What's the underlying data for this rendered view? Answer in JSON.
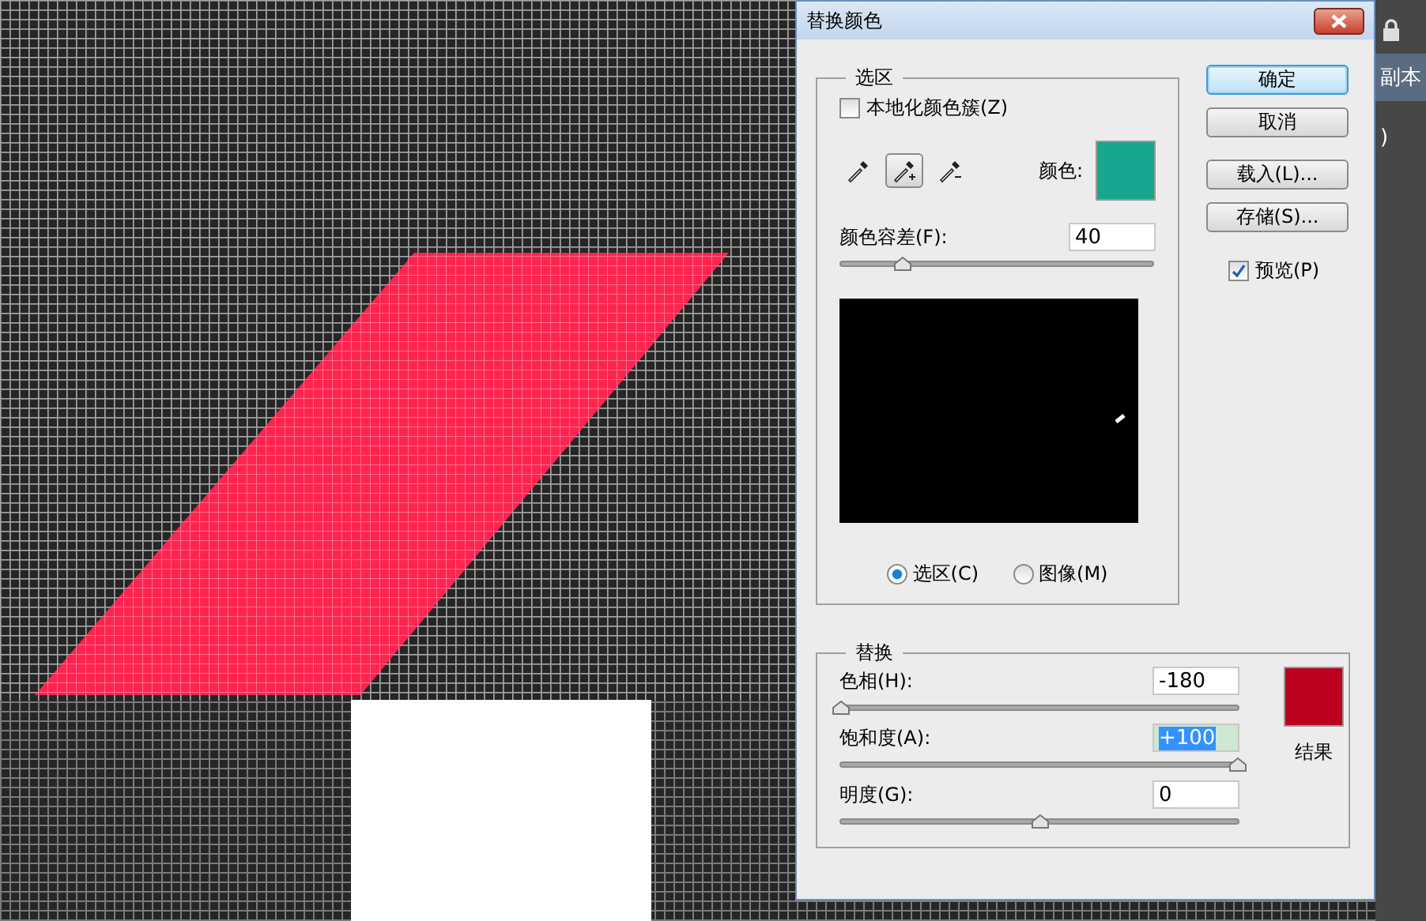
{
  "dialog": {
    "title": "替换颜色",
    "selection_group": {
      "title": "选区",
      "localized_clusters": {
        "label": "本地化颜色簇(Z)",
        "checked": false
      },
      "eyedroppers": [
        {
          "kind": "plain",
          "selected": false
        },
        {
          "kind": "add",
          "selected": true
        },
        {
          "kind": "subtract",
          "selected": false
        }
      ],
      "color_label": "颜色:",
      "color": "#17a78f",
      "fuzziness": {
        "label": "颜色容差(F):",
        "value": "40",
        "level": 0.2
      },
      "preview_modes": [
        {
          "label": "选区(C)",
          "selected": true
        },
        {
          "label": "图像(M)",
          "selected": false
        }
      ]
    },
    "buttons": [
      {
        "label": "确定",
        "default": true
      },
      {
        "label": "取消",
        "default": false
      },
      {
        "label": "载入(L)...",
        "default": false
      },
      {
        "label": "存储(S)...",
        "default": false
      }
    ],
    "preview": {
      "label": "预览(P)",
      "checked": true
    },
    "replacement_group": {
      "title": "替换",
      "sliders": [
        {
          "label": "色相(H):",
          "value": "-180",
          "level": 0,
          "text_selected": false
        },
        {
          "label": "饱和度(A):",
          "value": "+100",
          "level": 1,
          "text_selected": true
        },
        {
          "label": "明度(G):",
          "value": "0",
          "level": 0.5,
          "text_selected": false
        }
      ],
      "color": "#bb0020",
      "result_label": "结果"
    }
  },
  "layers_panel": {
    "items": [
      {
        "kind": "lock"
      },
      {
        "kind": "text",
        "label": "副本",
        "selected": true
      },
      {
        "kind": "text",
        "label": ")",
        "selected": false
      }
    ]
  }
}
